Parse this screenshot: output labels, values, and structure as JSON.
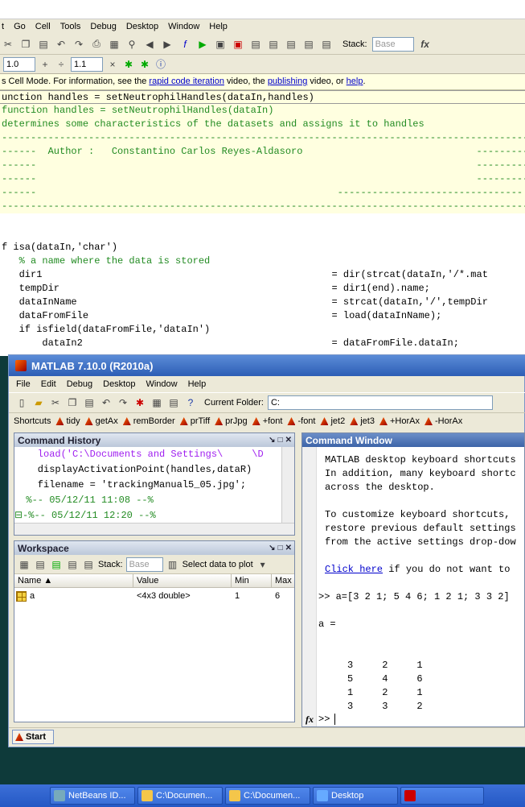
{
  "editor": {
    "menu": [
      "t",
      "Go",
      "Cell",
      "Tools",
      "Debug",
      "Desktop",
      "Window",
      "Help"
    ],
    "stack_label": "Stack:",
    "stack_value": "Base",
    "cell_value": "1.0",
    "cell_divisor": "1.1",
    "cellbar": {
      "prefix": "s Cell Mode. For information, see the ",
      "link1": "rapid code iteration",
      "mid1": " video, the ",
      "link2": "publishing",
      "mid2": " video, or ",
      "link3": "help",
      "suffix": "."
    },
    "code_lines": [
      "unction handles = setNeutrophilHandles(dataIn,handles)",
      "function handles = setNeutrophilHandles(dataIn)",
      "determines some characteristics of the datasets and assigns it to handles",
      "----------------------------------------------------------------------------------------------",
      "------  Author :   Constantino Carlos Reyes-Aldasoro                              ----------",
      "------                                                                            ----------",
      "------                                                                            ----------",
      "------                                                    --------------------------------",
      "----------------------------------------------------------------------------------------------",
      "",
      "",
      "f isa(dataIn,'char')",
      "   % a name where the data is stored",
      "   dir1                                                  = dir(strcat(dataIn,'/*.mat",
      "   tempDir                                               = dir1(end).name;",
      "   dataInName                                            = strcat(dataIn,'/',tempDir",
      "   dataFromFile                                          = load(dataInName);",
      "   if isfield(dataFromFile,'dataIn')",
      "       dataIn2                                           = dataFromFile.dataIn;"
    ]
  },
  "main_window": {
    "title": "MATLAB  7.10.0 (R2010a)",
    "menu": [
      "File",
      "Edit",
      "Debug",
      "Desktop",
      "Window",
      "Help"
    ],
    "current_folder_label": "Current Folder:",
    "current_folder_value": "C:",
    "shortcuts": [
      "Shortcuts",
      "tidy",
      "getAx",
      "remBorder",
      "prTiff",
      "prJpg",
      "+font",
      "-font",
      "jet2",
      "jet3",
      "+HorAx",
      "-HorAx"
    ],
    "history": {
      "title": "Command History",
      "lines": [
        "    load('C:\\Documents and Settings\\     \\D",
        "    displayActivationPoint(handles,dataR)",
        "    filename = 'trackingManual5_05.jpg';",
        "  %-- 05/12/11 11:08 --%",
        "⊟-%-- 05/12/11 12:20 --%"
      ]
    },
    "workspace": {
      "title": "Workspace",
      "stack_label": "Stack:",
      "stack_value": "Base",
      "select_plot": "Select data to plot",
      "columns": [
        "Name ▲",
        "Value",
        "Min",
        "Max"
      ],
      "rows": [
        {
          "name": "a",
          "value": "<4x3 double>",
          "min": "1",
          "max": "6"
        }
      ]
    },
    "command_window": {
      "title": "Command Window",
      "lines": [
        "MATLAB desktop keyboard shortcuts",
        "In addition, many keyboard shortc",
        "across the desktop.",
        "",
        "To customize keyboard shortcuts,",
        "restore previous default settings",
        "from the active settings drop-dow",
        "",
        "",
        "",
        ">> a=[3 2 1; 5 4 6; 1 2 1; 3 3 2]",
        "",
        "a =",
        "",
        "",
        "     3     2     1",
        "     5     4     6",
        "     1     2     1",
        "     3     3     2"
      ],
      "link_text": "Click here",
      "link_suffix": " if you do not want to",
      "prompt": ">>",
      "fx": "fx"
    },
    "start_label": "Start"
  },
  "taskbar": {
    "items": [
      "NetBeans ID...",
      "C:\\Documen...",
      "C:\\Documen...",
      "Desktop",
      ""
    ]
  }
}
